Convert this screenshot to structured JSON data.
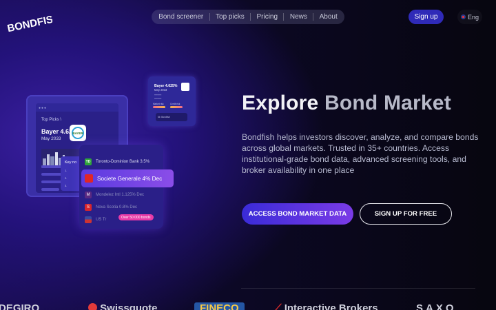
{
  "brand": {
    "logo_text": "BONDFISH"
  },
  "nav": {
    "items": [
      {
        "label": "Bond screener"
      },
      {
        "label": "Top picks"
      },
      {
        "label": "Pricing"
      },
      {
        "label": "News"
      },
      {
        "label": "About"
      }
    ]
  },
  "header": {
    "signup_label": "Sign up",
    "language_label": "Eng"
  },
  "hero": {
    "title_part1": "Explore",
    "title_part2": "Bond Market",
    "description": "Bondfish helps investors discover, analyze, and compare bonds across global markets. Trusted in 35+ countries. Access institutional-grade bond data, advanced screening tools, and broker availability in one place",
    "cta_primary": "ACCESS BOND MARKET DATA",
    "cta_secondary": "SIGN UP FOR FREE"
  },
  "illustration": {
    "tablet": {
      "label": "Top Picks \\",
      "bond_name": "Bayer 4.625%",
      "bond_date": "May 2033",
      "badge_text": "BAYER"
    },
    "key_module_title": "Key no",
    "mini_card": {
      "title": "Bayer 4.625%",
      "date": "May 2033",
      "label_a": "Market risk",
      "label_b": "Credit risk",
      "sub_label": "Mr. Bondfish"
    },
    "list": {
      "items": [
        {
          "label": "Toronto-Dominion Bank 3.5%",
          "icon_color": "#2ea33a",
          "icon_text": "TD"
        },
        {
          "label": "Societe Generale 4% Dec",
          "icon_color": "#e02626",
          "icon_text": ""
        },
        {
          "label": "Mondelez Intl 1.125% Dec",
          "icon_color": "#5a2a82",
          "icon_text": "M"
        },
        {
          "label": "Nova Scotia 0.8% Dec",
          "icon_color": "#d8262d",
          "icon_text": "S"
        },
        {
          "label": "US Tr",
          "icon_color": "#3a4aa0",
          "icon_text": ""
        }
      ],
      "badge": "Over 50 000 bonds"
    }
  },
  "partners": [
    "DEGIRO",
    "Swissquote",
    "FINECO",
    "Interactive Brokers",
    "SAXO"
  ]
}
